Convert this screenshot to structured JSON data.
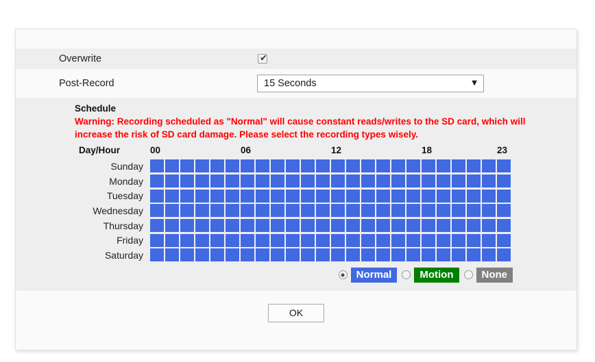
{
  "settings": {
    "overwrite": {
      "label": "Overwrite",
      "checked": true,
      "check_glyph": "✔"
    },
    "post_record": {
      "label": "Post-Record",
      "value": "15 Seconds",
      "caret_glyph": "▼",
      "options": [
        "15 Seconds"
      ]
    }
  },
  "schedule": {
    "title": "Schedule",
    "warning": "Warning:  Recording scheduled as \"Normal\" will cause constant reads/writes to the SD card, which will increase the risk of SD card damage. Please select the recording types wisely.",
    "warning_color": "#ff0000",
    "day_hour_label": "Day/Hour",
    "hour_ticks": [
      "00",
      "06",
      "12",
      "18",
      "23"
    ],
    "days": [
      "Sunday",
      "Monday",
      "Tuesday",
      "Wednesday",
      "Thursday",
      "Friday",
      "Saturday"
    ],
    "hours_per_day": 24,
    "cell_states": [
      [
        "normal",
        "normal",
        "normal",
        "normal",
        "normal",
        "normal",
        "normal",
        "normal",
        "normal",
        "normal",
        "normal",
        "normal",
        "normal",
        "normal",
        "normal",
        "normal",
        "normal",
        "normal",
        "normal",
        "normal",
        "normal",
        "normal",
        "normal",
        "normal"
      ],
      [
        "normal",
        "normal",
        "normal",
        "normal",
        "normal",
        "normal",
        "normal",
        "normal",
        "normal",
        "normal",
        "normal",
        "normal",
        "normal",
        "normal",
        "normal",
        "normal",
        "normal",
        "normal",
        "normal",
        "normal",
        "normal",
        "normal",
        "normal",
        "normal"
      ],
      [
        "normal",
        "normal",
        "normal",
        "normal",
        "normal",
        "normal",
        "normal",
        "normal",
        "normal",
        "normal",
        "normal",
        "normal",
        "normal",
        "normal",
        "normal",
        "normal",
        "normal",
        "normal",
        "normal",
        "normal",
        "normal",
        "normal",
        "normal",
        "normal"
      ],
      [
        "normal",
        "normal",
        "normal",
        "normal",
        "normal",
        "normal",
        "normal",
        "normal",
        "normal",
        "normal",
        "normal",
        "normal",
        "normal",
        "normal",
        "normal",
        "normal",
        "normal",
        "normal",
        "normal",
        "normal",
        "normal",
        "normal",
        "normal",
        "normal"
      ],
      [
        "normal",
        "normal",
        "normal",
        "normal",
        "normal",
        "normal",
        "normal",
        "normal",
        "normal",
        "normal",
        "normal",
        "normal",
        "normal",
        "normal",
        "normal",
        "normal",
        "normal",
        "normal",
        "normal",
        "normal",
        "normal",
        "normal",
        "normal",
        "normal"
      ],
      [
        "normal",
        "normal",
        "normal",
        "normal",
        "normal",
        "normal",
        "normal",
        "normal",
        "normal",
        "normal",
        "normal",
        "normal",
        "normal",
        "normal",
        "normal",
        "normal",
        "normal",
        "normal",
        "normal",
        "normal",
        "normal",
        "normal",
        "normal",
        "normal"
      ],
      [
        "normal",
        "normal",
        "normal",
        "normal",
        "normal",
        "normal",
        "normal",
        "normal",
        "normal",
        "normal",
        "normal",
        "normal",
        "normal",
        "normal",
        "normal",
        "normal",
        "normal",
        "normal",
        "normal",
        "normal",
        "normal",
        "normal",
        "normal",
        "normal"
      ]
    ],
    "legend": [
      {
        "label": "Normal",
        "color": "#4169e1",
        "selected": true
      },
      {
        "label": "Motion",
        "color": "#008000",
        "selected": false
      },
      {
        "label": "None",
        "color": "#808080",
        "selected": false
      }
    ]
  },
  "footer": {
    "ok_label": "OK"
  }
}
